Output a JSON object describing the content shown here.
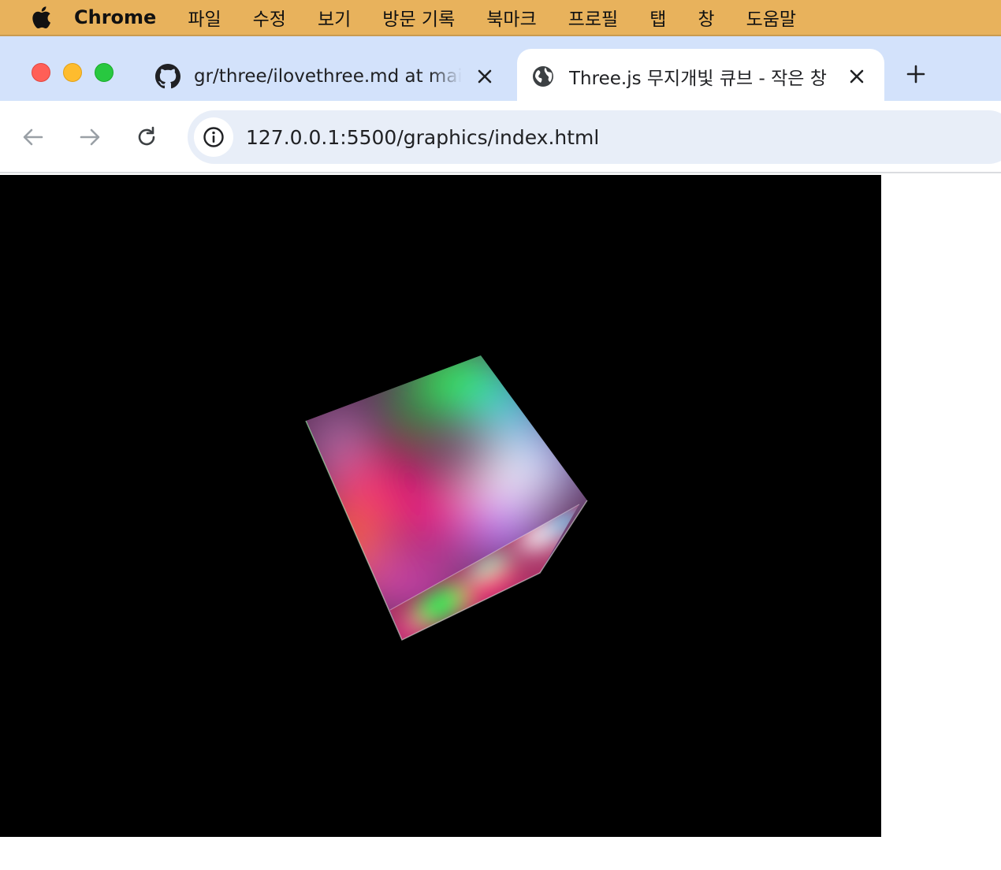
{
  "menubar": {
    "app_name": "Chrome",
    "items": [
      "파일",
      "수정",
      "보기",
      "방문 기록",
      "북마크",
      "프로필",
      "탭",
      "창",
      "도움말"
    ]
  },
  "tabs": [
    {
      "title": "gr/three/ilovethree.md at main",
      "favicon": "github-icon",
      "active": false
    },
    {
      "title": "Three.js 무지개빛 큐브 - 작은 창",
      "favicon": "globe-icon",
      "active": true
    }
  ],
  "toolbar": {
    "url": "127.0.0.1:5500/graphics/index.html"
  },
  "colors": {
    "menubar": "#e8b25c",
    "tabstrip": "#d3e2fb",
    "omnibox": "#e8eef8",
    "canvas": "#000000"
  },
  "content": {
    "scene": "rainbow-vertex-colored-cube"
  }
}
